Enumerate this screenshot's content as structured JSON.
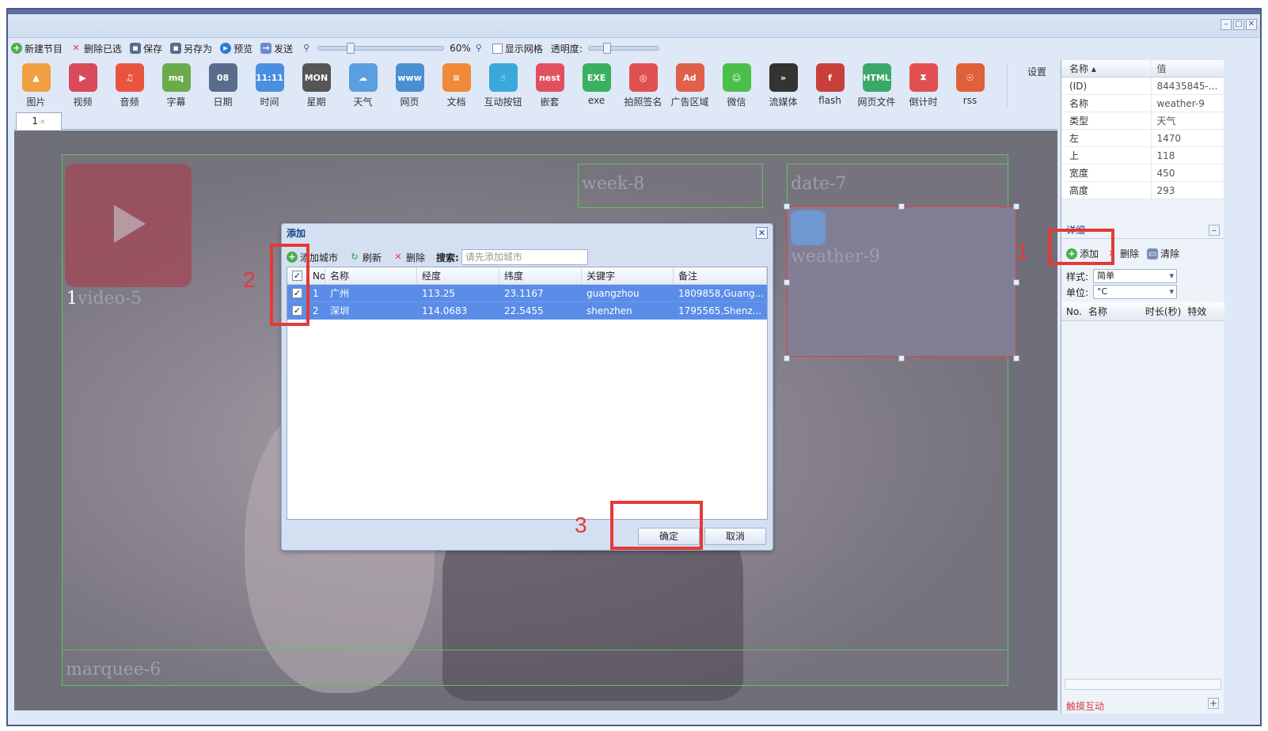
{
  "window": {
    "minimize": "–",
    "maximize": "□",
    "close": "✕"
  },
  "toolbar": {
    "new_program": "新建节目",
    "delete_selected": "删除已选",
    "save": "保存",
    "save_as": "另存为",
    "preview": "预览",
    "send": "发送",
    "zoom": "60%",
    "show_grid": "显示网格",
    "opacity": "透明度:"
  },
  "palette": [
    {
      "label": "图片",
      "icon": "image-icon",
      "color": "#f0a040",
      "glyph": "▲"
    },
    {
      "label": "视频",
      "icon": "video-icon",
      "color": "#d94a5a",
      "glyph": "▶"
    },
    {
      "label": "音频",
      "icon": "audio-icon",
      "color": "#e8553e",
      "glyph": "♫"
    },
    {
      "label": "字幕",
      "icon": "marquee-icon",
      "color": "#6bab4a",
      "glyph": "mq"
    },
    {
      "label": "日期",
      "icon": "date-icon",
      "color": "#5a6b8c",
      "glyph": "08"
    },
    {
      "label": "时间",
      "icon": "time-icon",
      "color": "#4a8fe0",
      "glyph": "11:11"
    },
    {
      "label": "星期",
      "icon": "week-icon",
      "color": "#555555",
      "glyph": "MON"
    },
    {
      "label": "天气",
      "icon": "weather-icon",
      "color": "#5a9fe0",
      "glyph": "☁"
    },
    {
      "label": "网页",
      "icon": "webpage-icon",
      "color": "#4a8fd0",
      "glyph": "www"
    },
    {
      "label": "文档",
      "icon": "document-icon",
      "color": "#f08a3a",
      "glyph": "≡"
    },
    {
      "label": "互动按钮",
      "icon": "interactive-button-icon",
      "color": "#3aa8d8",
      "glyph": "☝"
    },
    {
      "label": "嵌套",
      "icon": "nesting-icon",
      "color": "#e05060",
      "glyph": "nest"
    },
    {
      "label": "exe",
      "icon": "exe-icon",
      "color": "#3ab060",
      "glyph": "EXE"
    },
    {
      "label": "拍照签名",
      "icon": "photo-sign-icon",
      "color": "#e05050",
      "glyph": "◎"
    },
    {
      "label": "广告区域",
      "icon": "ad-icon",
      "color": "#e0604a",
      "glyph": "Ad"
    },
    {
      "label": "微信",
      "icon": "wechat-icon",
      "color": "#4cbf4a",
      "glyph": "☺"
    },
    {
      "label": "流媒体",
      "icon": "streaming-icon",
      "color": "#333333",
      "glyph": "»"
    },
    {
      "label": "flash",
      "icon": "flash-icon",
      "color": "#c8403a",
      "glyph": "f"
    },
    {
      "label": "网页文件",
      "icon": "html-icon",
      "color": "#3aa86a",
      "glyph": "HTML"
    },
    {
      "label": "倒计时",
      "icon": "countdown-icon",
      "color": "#e05050",
      "glyph": "⧗"
    },
    {
      "label": "rss",
      "icon": "rss-icon",
      "color": "#e0603a",
      "glyph": "☉"
    }
  ],
  "settings": "设置",
  "tab": {
    "label": "1"
  },
  "canvas": {
    "regions": {
      "video": "video-5",
      "video_prefix": "1",
      "week": "week-8",
      "date": "date-7",
      "weather": "weather-9",
      "marquee": "marquee-6"
    }
  },
  "dialog": {
    "title": "添加",
    "add_city": "添加城市",
    "refresh": "刷新",
    "delete": "删除",
    "search_label": "搜索:",
    "search_placeholder": "请先添加城市",
    "columns": [
      "No.",
      "名称",
      "经度",
      "纬度",
      "关键字",
      "备注"
    ],
    "rows": [
      {
        "no": "1",
        "name": "广州",
        "lng": "113.25",
        "lat": "23.1167",
        "keyword": "guangzhou",
        "note": "1809858,Guang..."
      },
      {
        "no": "2",
        "name": "深圳",
        "lng": "114.0683",
        "lat": "22.5455",
        "keyword": "shenzhen",
        "note": "1795565,Shenz..."
      }
    ],
    "ok": "确定",
    "cancel": "取消"
  },
  "annotations": {
    "one": "1",
    "two": "2",
    "three": "3"
  },
  "properties": {
    "header_name": "名称 ▴",
    "header_value": "值",
    "rows": [
      {
        "key": "(ID)",
        "value": "84435845-..."
      },
      {
        "key": "名称",
        "value": "weather-9"
      },
      {
        "key": "类型",
        "value": "天气"
      },
      {
        "key": "左",
        "value": "1470"
      },
      {
        "key": "上",
        "value": "118"
      },
      {
        "key": "宽度",
        "value": "450"
      },
      {
        "key": "高度",
        "value": "293"
      }
    ]
  },
  "detail": {
    "title": "详细",
    "add": "添加",
    "delete": "删除",
    "clear": "清除",
    "style_label": "样式:",
    "style_value": "简单",
    "unit_label": "单位:",
    "unit_value": "°C",
    "list_cols": [
      "No.",
      "名称",
      "时长(秒)",
      "特效"
    ],
    "touch_interaction": "触摸互动"
  }
}
